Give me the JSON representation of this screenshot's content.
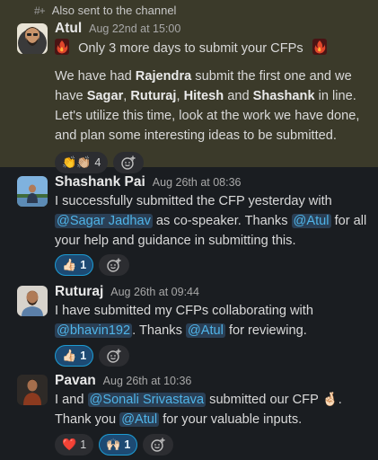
{
  "thread_note": "Also sent to the channel",
  "colors": {
    "highlight": "#3b3a2a",
    "mention_bg": "#2a3f55",
    "mention_text": "#4fb4e8",
    "reaction_active": "#1d4a73"
  },
  "messages": [
    {
      "author": "Atul",
      "time": "Aug 22nd at 15:00",
      "title_line": "Only 3 more days to submit your CFPs",
      "body": {
        "p1": "We have had ",
        "n1": "Rajendra",
        "p2": " submit the first one and we have ",
        "n2": "Sagar",
        "p3": ", ",
        "n3": "Ruturaj",
        "p4": ", ",
        "n4": "Hitesh",
        "p5": " and ",
        "n5": "Shashank",
        "p6": " in line. Let's utilize this time, look at the work we have done, and plan some interesting ideas to be submitted."
      },
      "reactions": [
        {
          "emoji": "👏👏🏼",
          "count": "4",
          "active": false
        }
      ]
    },
    {
      "author": "Shashank Pai",
      "time": "Aug 26th at 08:36",
      "body": {
        "p1": "I successfully submitted the CFP yesterday with ",
        "m1": "@Sagar Jadhav",
        "p2": " as co-speaker. Thanks ",
        "m2": "@Atul",
        "p3": " for all your help and guidance in submitting this."
      },
      "reactions": [
        {
          "emoji": "👍🏻",
          "count": "1",
          "active": true
        }
      ]
    },
    {
      "author": "Ruturaj",
      "time": "Aug 26th at 09:44",
      "body": {
        "p1": "I have submitted my CFPs collaborating with ",
        "m1": "@bhavin192",
        "p2": ". Thanks ",
        "m2": "@Atul",
        "p3": " for reviewing."
      },
      "reactions": [
        {
          "emoji": "👍🏻",
          "count": "1",
          "active": true
        }
      ]
    },
    {
      "author": "Pavan",
      "time": "Aug 26th at 10:36",
      "body": {
        "p1": "I and ",
        "m1": "@Sonali Srivastava",
        "p2": " submitted our CFP ",
        "e1": "🤞🏻",
        "p3": ". Thank you ",
        "m2": "@Atul",
        "p4": " for your valuable inputs."
      },
      "reactions": [
        {
          "emoji": "❤️",
          "count": "1",
          "active": false
        },
        {
          "emoji": "🙌🏻",
          "count": "1",
          "active": true
        }
      ]
    }
  ]
}
